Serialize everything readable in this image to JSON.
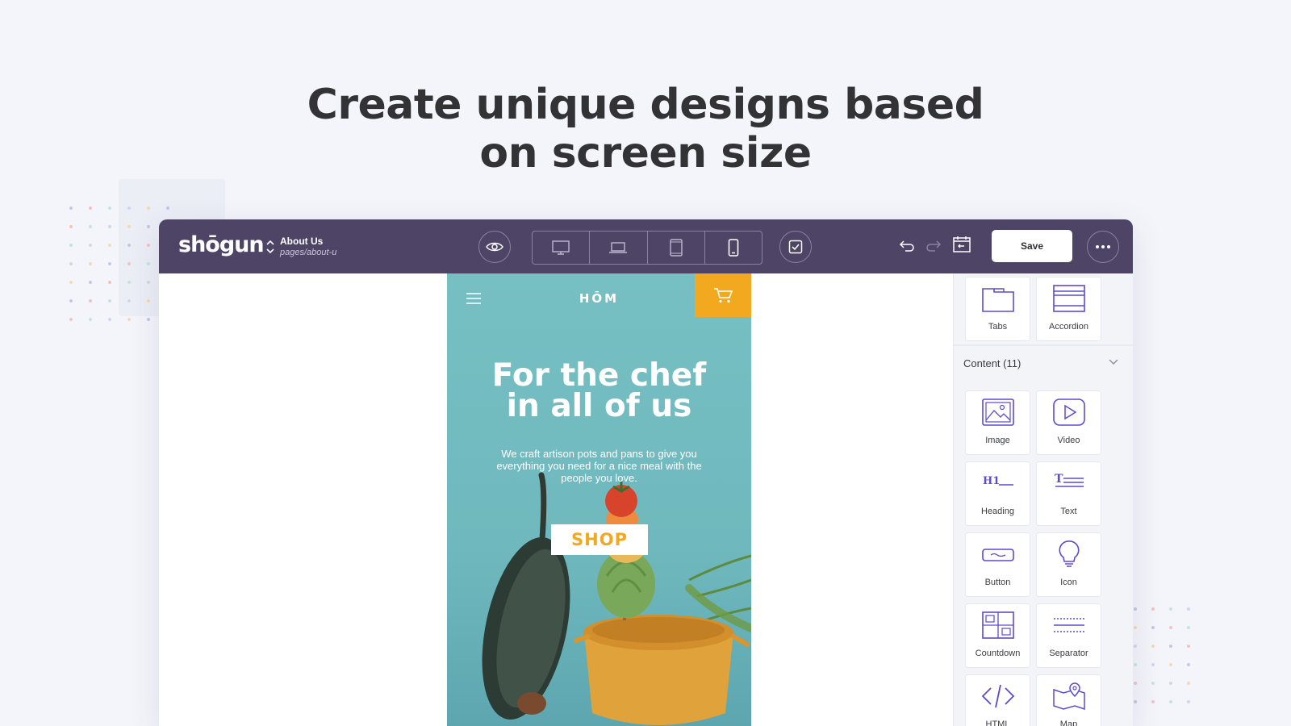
{
  "headline": {
    "line1": "Create unique designs based",
    "line2": "on screen size"
  },
  "topbar": {
    "logo": "shōgun",
    "page_title": "About Us",
    "page_path": "pages/about-u",
    "save_label": "Save"
  },
  "preview": {
    "brand": "HŌM",
    "title_line1": "For the chef",
    "title_line2": "in all of us",
    "subtitle": "We craft artison pots and pans to give you everything you need for a nice meal with the people you love.",
    "cta": "SHOP"
  },
  "panel": {
    "layout_items": [
      {
        "label": "Tabs",
        "icon": "tabs-icon"
      },
      {
        "label": "Accordion",
        "icon": "accordion-icon"
      }
    ],
    "content_section_label": "Content (11)",
    "content_items": [
      {
        "label": "Image",
        "icon": "image-icon"
      },
      {
        "label": "Video",
        "icon": "video-icon"
      },
      {
        "label": "Heading",
        "icon": "heading-icon"
      },
      {
        "label": "Text",
        "icon": "text-icon"
      },
      {
        "label": "Button",
        "icon": "button-icon"
      },
      {
        "label": "Icon",
        "icon": "lightbulb-icon"
      },
      {
        "label": "Countdown",
        "icon": "countdown-icon"
      },
      {
        "label": "Separator",
        "icon": "separator-icon"
      },
      {
        "label": "HTML",
        "icon": "code-icon"
      },
      {
        "label": "Map",
        "icon": "map-icon"
      }
    ]
  },
  "colors": {
    "topbar": "#4e4466",
    "accent": "#f2a91f",
    "preview_bg": "#76bfc3",
    "icon_stroke": "#5d4bc9"
  }
}
